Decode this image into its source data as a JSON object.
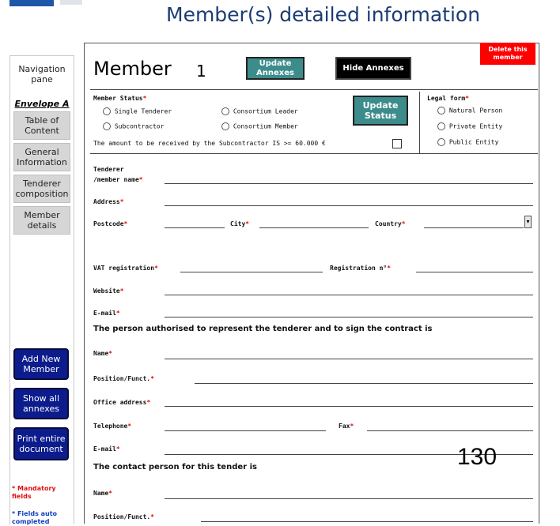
{
  "page_title": "Member(s) detailed information",
  "nav": {
    "pane_title": "Navigation pane",
    "envelope": "Envelope A",
    "items": [
      {
        "label": "Table of Content"
      },
      {
        "label": "General Information"
      },
      {
        "label": "Tenderer composition"
      },
      {
        "label": "Member details"
      }
    ],
    "actions": [
      {
        "label": "Add New Member"
      },
      {
        "label": "Show all annexes"
      },
      {
        "label": "Print entire document"
      }
    ],
    "note_mandatory": "* Mandatory fields",
    "note_auto": "* Fields auto completed"
  },
  "member": {
    "title": "Member",
    "number": "1",
    "update_annexes": "Update Annexes",
    "hide_annexes": "Hide Annexes",
    "delete": "Delete this member"
  },
  "status": {
    "label": "Member Status",
    "options": [
      "Single Tenderer",
      "Consortium Leader",
      "Subcontractor",
      "Consortium Member"
    ],
    "update_button": "Update Status",
    "subcontractor_amount": "The amount to be received by the Subcontractor IS >= 60.000 €"
  },
  "legal_form": {
    "label": "Legal form",
    "options": [
      "Natural Person",
      "Private Entity",
      "Public Entity"
    ]
  },
  "fields": {
    "tenderer_name_1": "Tenderer",
    "tenderer_name_2": "/member name",
    "address": "Address",
    "postcode": "Postcode",
    "city": "City",
    "country": "Country",
    "vat": "VAT registration",
    "registration": "Registration n°",
    "website": "Website",
    "email": "E-mail"
  },
  "representative": {
    "heading": "The person authorised to represent the tenderer and to sign the contract is",
    "name": "Name",
    "position": "Position/Funct.",
    "office_address": "Office address",
    "telephone": "Telephone",
    "fax": "Fax",
    "email": "E-mail"
  },
  "contact": {
    "heading": "The contact person for this tender is",
    "name": "Name",
    "position": "Position/Funct."
  },
  "required_mark": "*",
  "dropdown_glyph": "▾",
  "overlay_number": "130",
  "colors": {
    "title": "#1c3c74",
    "teal_button": "#3d8c8c",
    "delete_button": "#ff0000",
    "nav_action": "#0c1c8c",
    "required": "#e01010"
  }
}
